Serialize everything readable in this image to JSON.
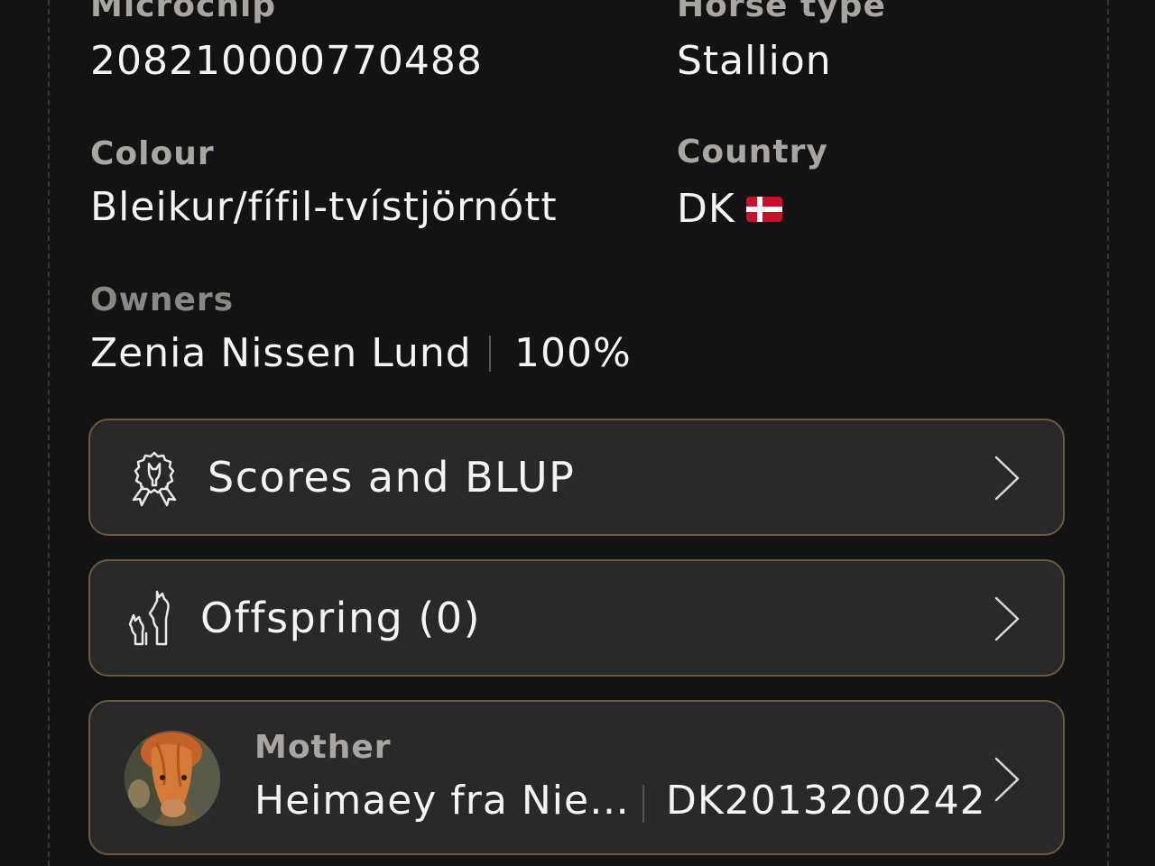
{
  "details": {
    "microchip_label": "Microchip",
    "microchip_value": "208210000770488",
    "horse_type_label": "Horse type",
    "horse_type_value": "Stallion",
    "colour_label": "Colour",
    "colour_value": "Bleikur/fífil-tvístjörnótt",
    "country_label": "Country",
    "country_value": "DK",
    "country_flag_icon": "denmark-flag-icon",
    "owners_label": "Owners",
    "owner_name": "Zenia Nissen Lund",
    "owner_share": "100%"
  },
  "cards": {
    "scores_label": "Scores and BLUP",
    "scores_icon": "rosette-horse-icon",
    "offspring_label": "Offspring (0)",
    "offspring_icon": "foal-horse-icon",
    "mother_label": "Mother",
    "mother_name": "Heimaey fra Nie…",
    "mother_id": "DK2013200242"
  },
  "colors": {
    "background": "#131313",
    "card_background": "#292929",
    "card_border": "#6b5a42",
    "label_gray": "#a9a6a1",
    "value_white": "#f4f4f4"
  }
}
